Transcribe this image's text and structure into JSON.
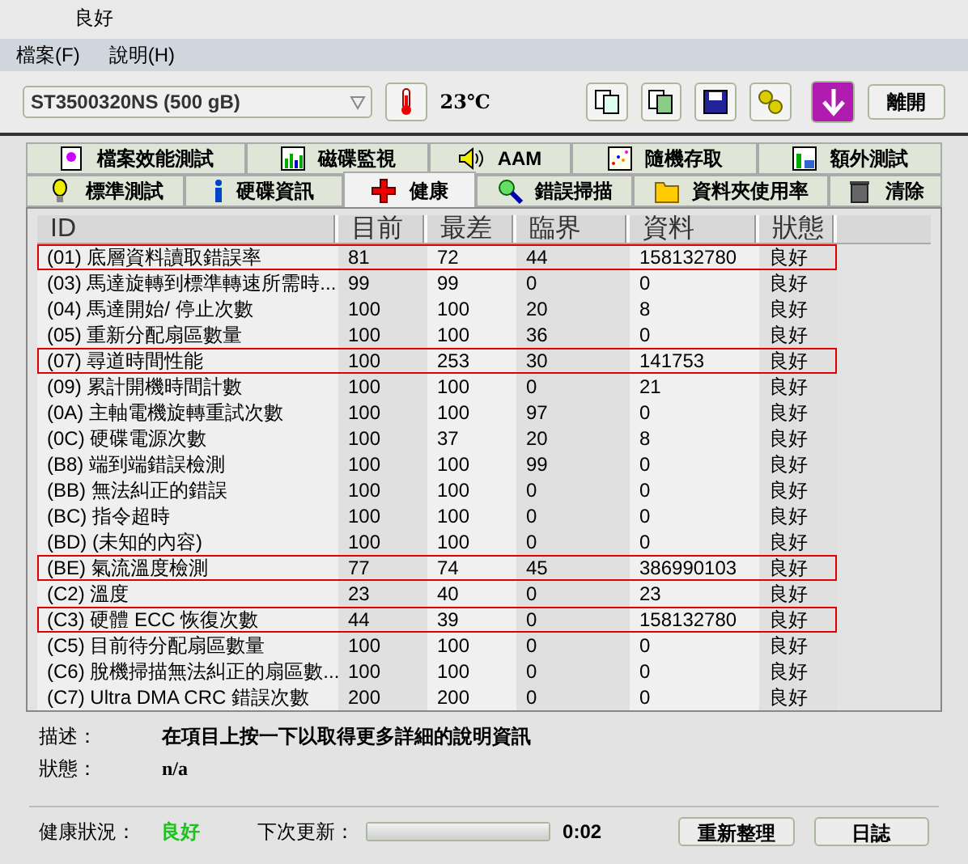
{
  "background_window": {
    "text": "良好"
  },
  "menu": [
    {
      "label": "檔案(F)"
    },
    {
      "label": "說明(H)"
    }
  ],
  "toolbar": {
    "drive": "ST3500320NS (500 gB)",
    "temperature": "23℃",
    "exit_button": "離開"
  },
  "tabs": [
    [
      {
        "label": "檔案效能測試",
        "selected": false
      },
      {
        "label": "磁碟監視",
        "selected": false
      },
      {
        "label": "AAM",
        "selected": false
      },
      {
        "label": "隨機存取",
        "selected": false
      },
      {
        "label": "額外測試",
        "selected": false
      }
    ],
    [
      {
        "label": "標準測試",
        "selected": false
      },
      {
        "label": "硬碟資訊",
        "selected": false
      },
      {
        "label": "健康",
        "selected": true
      },
      {
        "label": "錯誤掃描",
        "selected": false
      },
      {
        "label": "資料夾使用率",
        "selected": false
      },
      {
        "label": "清除",
        "selected": false
      }
    ]
  ],
  "table": {
    "columns": [
      "ID",
      "目前",
      "最差",
      "臨界",
      "資料",
      "狀態"
    ],
    "rows": [
      {
        "cells": [
          "(01) 底層資料讀取錯誤率",
          "81",
          "72",
          "44",
          "158132780",
          "良好"
        ],
        "highlighted": true
      },
      {
        "cells": [
          "(03) 馬達旋轉到標準轉速所需時...",
          "99",
          "99",
          "0",
          "0",
          "良好"
        ],
        "highlighted": false
      },
      {
        "cells": [
          "(04) 馬達開始/ 停止次數",
          "100",
          "100",
          "20",
          "8",
          "良好"
        ],
        "highlighted": false
      },
      {
        "cells": [
          "(05) 重新分配扇區數量",
          "100",
          "100",
          "36",
          "0",
          "良好"
        ],
        "highlighted": false
      },
      {
        "cells": [
          "(07) 尋道時間性能",
          "100",
          "253",
          "30",
          "141753",
          "良好"
        ],
        "highlighted": true
      },
      {
        "cells": [
          "(09) 累計開機時間計數",
          "100",
          "100",
          "0",
          "21",
          "良好"
        ],
        "highlighted": false
      },
      {
        "cells": [
          "(0A) 主軸電機旋轉重試次數",
          "100",
          "100",
          "97",
          "0",
          "良好"
        ],
        "highlighted": false
      },
      {
        "cells": [
          "(0C) 硬碟電源次數",
          "100",
          "37",
          "20",
          "8",
          "良好"
        ],
        "highlighted": false
      },
      {
        "cells": [
          "(B8) 端到端錯誤檢測",
          "100",
          "100",
          "99",
          "0",
          "良好"
        ],
        "highlighted": false
      },
      {
        "cells": [
          "(BB) 無法糾正的錯誤",
          "100",
          "100",
          "0",
          "0",
          "良好"
        ],
        "highlighted": false
      },
      {
        "cells": [
          "(BC) 指令超時",
          "100",
          "100",
          "0",
          "0",
          "良好"
        ],
        "highlighted": false
      },
      {
        "cells": [
          "(BD) (未知的內容)",
          "100",
          "100",
          "0",
          "0",
          "良好"
        ],
        "highlighted": false
      },
      {
        "cells": [
          "(BE) 氣流溫度檢測",
          "77",
          "74",
          "45",
          "386990103",
          "良好"
        ],
        "highlighted": true
      },
      {
        "cells": [
          "(C2) 溫度",
          "23",
          "40",
          "0",
          "23",
          "良好"
        ],
        "highlighted": false
      },
      {
        "cells": [
          "(C3) 硬體 ECC 恢復次數",
          "44",
          "39",
          "0",
          "158132780",
          "良好"
        ],
        "highlighted": true
      },
      {
        "cells": [
          "(C5) 目前待分配扇區數量",
          "100",
          "100",
          "0",
          "0",
          "良好"
        ],
        "highlighted": false
      },
      {
        "cells": [
          "(C6) 脫機掃描無法糾正的扇區數...",
          "100",
          "100",
          "0",
          "0",
          "良好"
        ],
        "highlighted": false
      },
      {
        "cells": [
          "(C7) Ultra DMA CRC 錯誤次數",
          "200",
          "200",
          "0",
          "0",
          "良好"
        ],
        "highlighted": false
      }
    ]
  },
  "details": {
    "description_label": "描述：",
    "description": "在項目上按一下以取得更多詳細的說明資訊",
    "status_label": "狀態：",
    "status": "n/a"
  },
  "footer": {
    "health_label": "健康狀況：",
    "health": "良好",
    "next_update_label": "下次更新：",
    "next_update": {
      "level": 1
    },
    "countdown": "0:02",
    "buttons": [
      "重新整理",
      "日誌"
    ]
  }
}
